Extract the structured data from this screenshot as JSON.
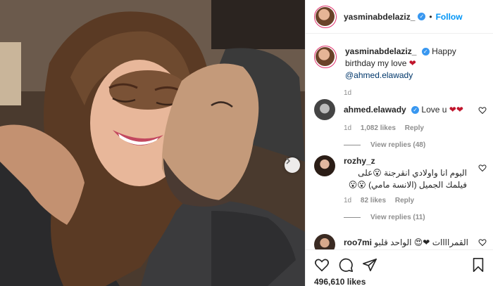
{
  "post": {
    "username": "yasminabdelaziz_",
    "separator": "•",
    "follow_label": "Follow",
    "caption": {
      "username": "yasminabdelaziz_",
      "text_before": "Happy birthday my love",
      "heart": "❤",
      "mention": "@ahmed.elawady",
      "time": "1d"
    },
    "likes": "496,610 likes"
  },
  "comments": [
    {
      "username": "ahmed.elawady",
      "verified": true,
      "text": "Love u",
      "emoji": "❤❤",
      "time": "1d",
      "likes": "1,082 likes",
      "reply_label": "Reply",
      "view_replies": "View replies (48)"
    },
    {
      "username": "rozhy_z",
      "verified": false,
      "text": "اليوم انا واولادي انقرجنة 😮على فيلمك الجميل (الانسة مامي)",
      "emoji": "😮😮",
      "time": "1d",
      "likes": "82 likes",
      "reply_label": "Reply",
      "view_replies": "View replies (11)"
    },
    {
      "username": "roo7mi",
      "verified": false,
      "text": "القمراااات ❤😍 الواحد قلبو",
      "emoji": ""
    }
  ],
  "colors": {
    "verified": "#3897f0",
    "follow": "#0095f6",
    "mention": "#00376b",
    "heart": "#c0152c",
    "muted": "#8e8e8e"
  },
  "icons": {
    "like": "heart-outline-icon",
    "comment": "speech-bubble-icon",
    "share": "paper-plane-icon",
    "save": "bookmark-icon",
    "next": "chevron-right-icon"
  }
}
